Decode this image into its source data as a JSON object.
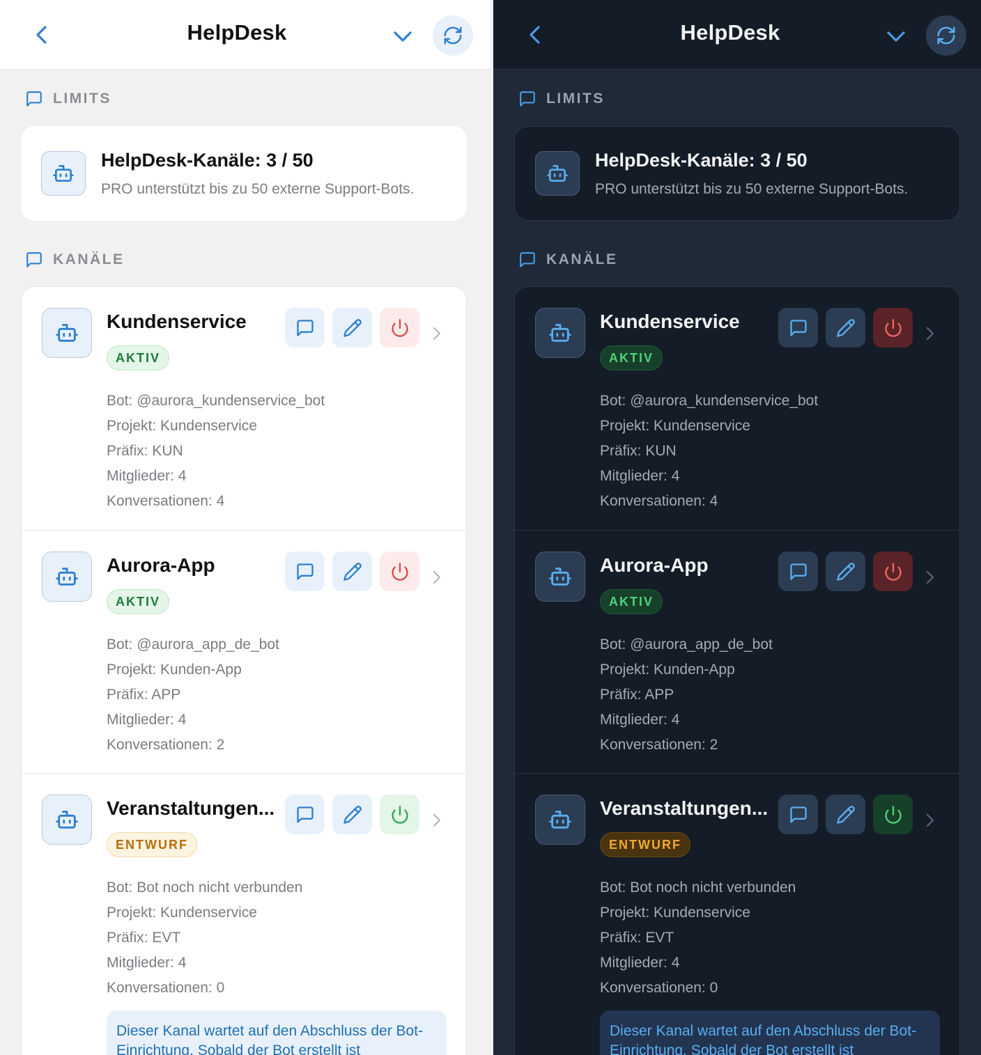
{
  "header": {
    "title": "HelpDesk"
  },
  "limits": {
    "section_label": "LIMITS",
    "card_title": "HelpDesk-Kanäle: 3 / 50",
    "card_subtitle": "PRO unterstützt bis zu 50 externe Support-Bots."
  },
  "channels_section": {
    "section_label": "KANÄLE"
  },
  "channels": [
    {
      "name": "Kundenservice",
      "status": "AKTIV",
      "bot": "Bot: @aurora_kundenservice_bot",
      "project": "Projekt: Kundenservice",
      "prefix": "Präfix: KUN",
      "members": "Mitglieder: 4",
      "conversations": "Konversationen: 4"
    },
    {
      "name": "Aurora-App",
      "status": "AKTIV",
      "bot": "Bot: @aurora_app_de_bot",
      "project": "Projekt: Kunden-App",
      "prefix": "Präfix: APP",
      "members": "Mitglieder: 4",
      "conversations": "Konversationen: 2"
    },
    {
      "name": "Veranstaltungen...",
      "status": "ENTWURF",
      "bot": "Bot: Bot noch nicht verbunden",
      "project": "Projekt: Kundenservice",
      "prefix": "Präfix: EVT",
      "members": "Mitglieder: 4",
      "conversations": "Konversationen: 0",
      "notice": "Dieser Kanal wartet auf den Abschluss der Bot-Einrichtung. Sobald der Bot erstellt ist"
    }
  ],
  "colors": {
    "accent_blue": "#2f7fd0",
    "danger_red": "#dc4a4a",
    "success_green": "#2fa556",
    "dark_background": "#1f2937"
  }
}
